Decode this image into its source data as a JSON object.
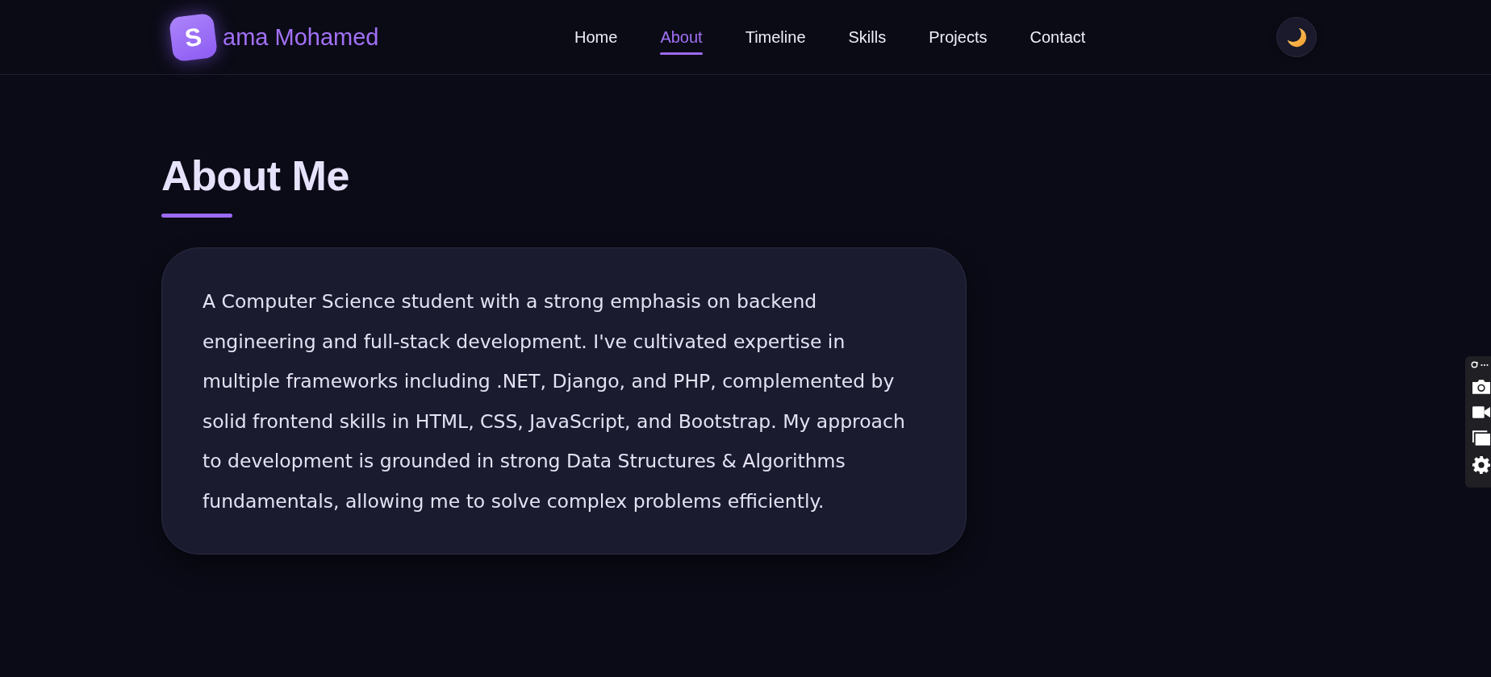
{
  "header": {
    "logo": {
      "letter": "S",
      "name": "ama Mohamed"
    },
    "nav": [
      {
        "label": "Home",
        "selected": false
      },
      {
        "label": "About",
        "selected": true
      },
      {
        "label": "Timeline",
        "selected": false
      },
      {
        "label": "Skills",
        "selected": false
      },
      {
        "label": "Projects",
        "selected": false
      },
      {
        "label": "Contact",
        "selected": false
      }
    ]
  },
  "about": {
    "title": "About Me",
    "text": "A Computer Science student with a strong emphasis on backend engineering and full-stack development. I've cultivated expertise in multiple frameworks including .NET, Django, and PHP, complemented by solid frontend skills in HTML, CSS, JavaScript, and Bootstrap. My approach to development is grounded in strong Data Structures & Algorithms fundamentals, allowing me to solve complex problems efficiently."
  }
}
